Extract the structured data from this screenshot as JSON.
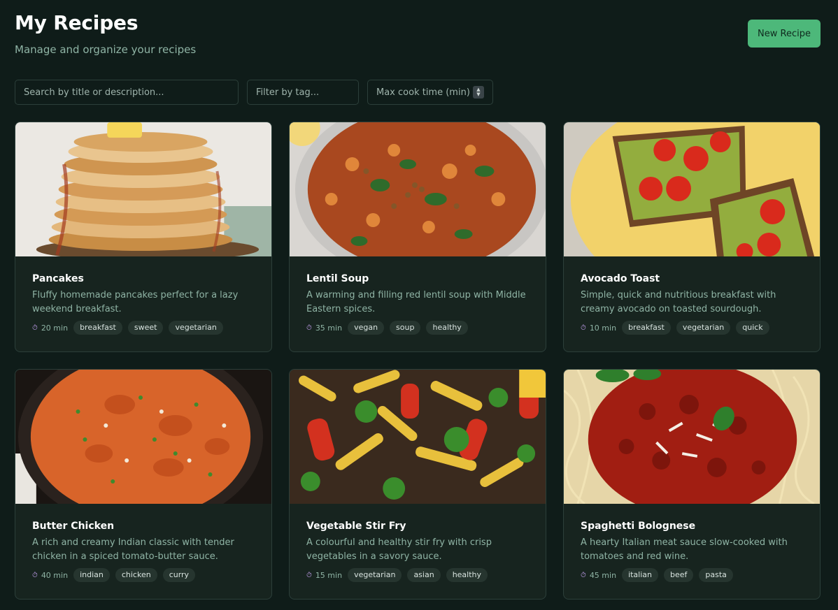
{
  "header": {
    "title": "My Recipes",
    "subtitle": "Manage and organize your recipes",
    "new_button": "New Recipe"
  },
  "filters": {
    "search_placeholder": "Search by title or description...",
    "tag_placeholder": "Filter by tag...",
    "time_placeholder": "Max cook time (min)"
  },
  "colors": {
    "accent": "#4db87a",
    "background": "#0f1c19",
    "card": "#17241f"
  },
  "recipes": [
    {
      "title": "Pancakes",
      "description": "Fluffy homemade pancakes perfect for a lazy weekend breakfast.",
      "time": "20 min",
      "tags": [
        "breakfast",
        "sweet",
        "vegetarian"
      ],
      "image": "pancakes-photo"
    },
    {
      "title": "Lentil Soup",
      "description": "A warming and filling red lentil soup with Middle Eastern spices.",
      "time": "35 min",
      "tags": [
        "vegan",
        "soup",
        "healthy"
      ],
      "image": "lentil-soup-photo"
    },
    {
      "title": "Avocado Toast",
      "description": "Simple, quick and nutritious breakfast with creamy avocado on toasted sourdough.",
      "time": "10 min",
      "tags": [
        "breakfast",
        "vegetarian",
        "quick"
      ],
      "image": "avocado-toast-photo"
    },
    {
      "title": "Butter Chicken",
      "description": "A rich and creamy Indian classic with tender chicken in a spiced tomato-butter sauce.",
      "time": "40 min",
      "tags": [
        "indian",
        "chicken",
        "curry"
      ],
      "image": "butter-chicken-photo"
    },
    {
      "title": "Vegetable Stir Fry",
      "description": "A colourful and healthy stir fry with crisp vegetables in a savory sauce.",
      "time": "15 min",
      "tags": [
        "vegetarian",
        "asian",
        "healthy"
      ],
      "image": "stir-fry-photo"
    },
    {
      "title": "Spaghetti Bolognese",
      "description": "A hearty Italian meat sauce slow-cooked with tomatoes and red wine.",
      "time": "45 min",
      "tags": [
        "italian",
        "beef",
        "pasta"
      ],
      "image": "bolognese-photo"
    }
  ]
}
